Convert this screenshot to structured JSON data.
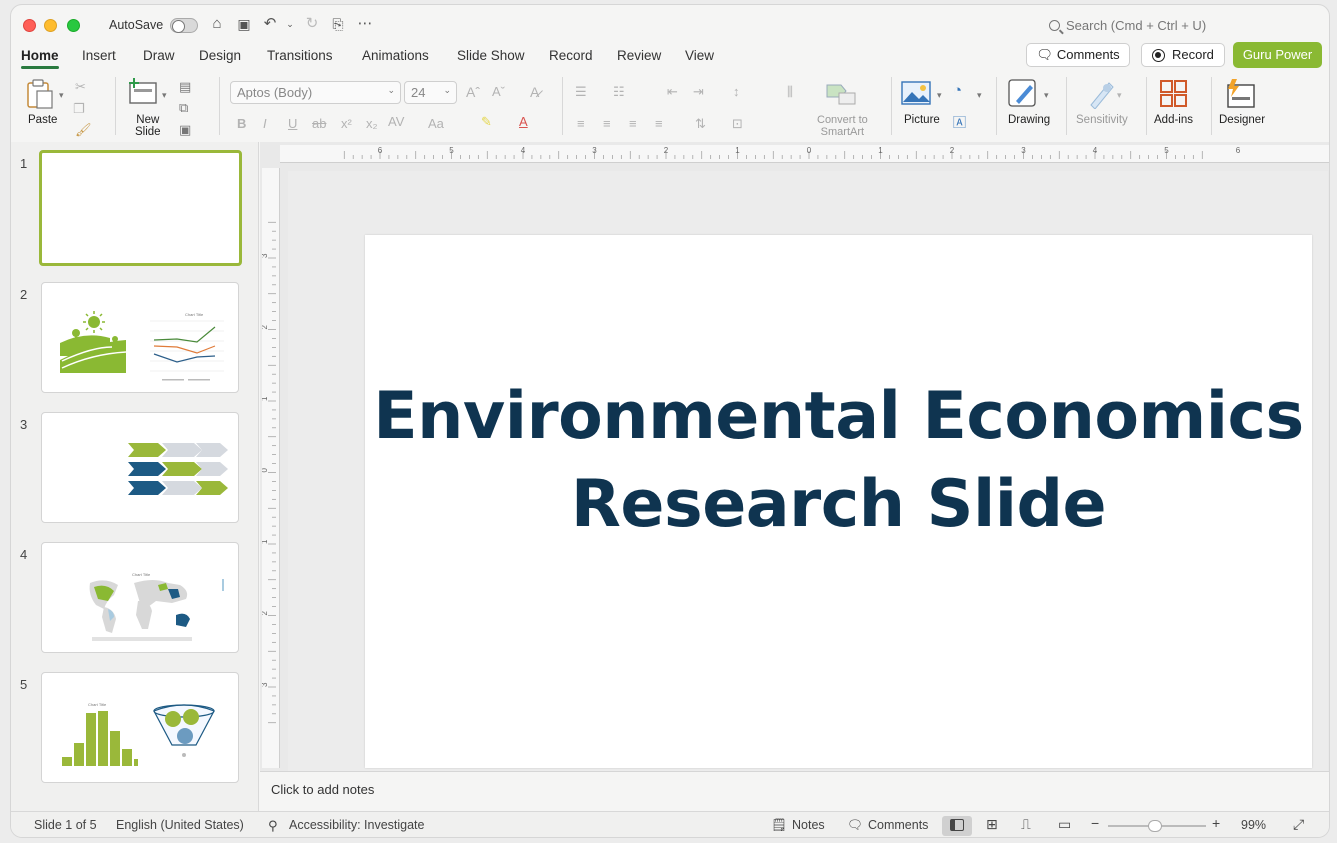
{
  "titlebar": {
    "autosave_label": "AutoSave",
    "search_placeholder": "Search (Cmd + Ctrl + U)"
  },
  "tabs": [
    "Home",
    "Insert",
    "Draw",
    "Design",
    "Transitions",
    "Animations",
    "Slide Show",
    "Record",
    "Review",
    "View"
  ],
  "active_tab": "Home",
  "header_buttons": {
    "comments": "Comments",
    "record": "Record",
    "guru": "Guru Power"
  },
  "ribbon": {
    "paste": "Paste",
    "new_slide": "New\nSlide",
    "font_name": "Aptos (Body)",
    "font_size": "24",
    "convert_smartart": "Convert to\nSmartArt",
    "picture": "Picture",
    "drawing": "Drawing",
    "sensitivity": "Sensitivity",
    "addins": "Add-ins",
    "designer": "Designer"
  },
  "thumbnails": [
    {
      "number": "1",
      "selected": true
    },
    {
      "number": "2",
      "selected": false,
      "chart_title": "Chart Title"
    },
    {
      "number": "3",
      "selected": false
    },
    {
      "number": "4",
      "selected": false,
      "chart_title": "Chart Title"
    },
    {
      "number": "5",
      "selected": false,
      "chart_title": "Chart Title"
    }
  ],
  "slide": {
    "title": "Environmental Economics Research Slide",
    "title_color": "#0f3450"
  },
  "notes_placeholder": "Click to add notes",
  "status": {
    "slide_counter": "Slide 1 of 5",
    "language": "English (United States)",
    "accessibility": "Accessibility: Investigate",
    "notes": "Notes",
    "comments": "Comments",
    "zoom": "99%"
  },
  "ruler": {
    "h_ticks": [
      "6",
      "5",
      "4",
      "3",
      "2",
      "1",
      "0",
      "1",
      "2",
      "3",
      "4",
      "5",
      "6"
    ],
    "v_ticks": [
      "3",
      "2",
      "1",
      "0",
      "1",
      "2",
      "3"
    ]
  },
  "colors": {
    "accent_green": "#8ab933",
    "tab_underline": "#2a7a3f",
    "title_navy": "#0f3450"
  }
}
